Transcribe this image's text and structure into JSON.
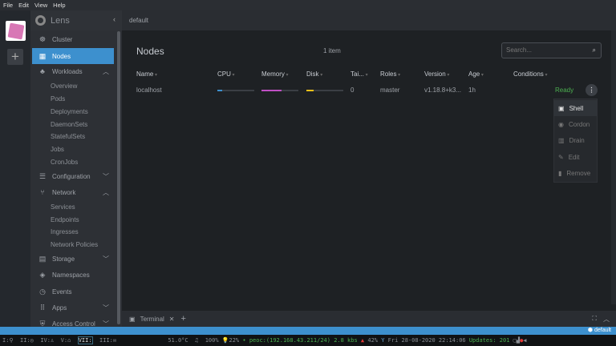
{
  "menubar": {
    "items": [
      "File",
      "Edit",
      "View",
      "Help"
    ]
  },
  "sidebar": {
    "title": "Lens",
    "items": {
      "cluster": "Cluster",
      "nodes": "Nodes",
      "workloads": "Workloads",
      "overview": "Overview",
      "pods": "Pods",
      "deployments": "Deployments",
      "daemonsets": "DaemonSets",
      "statefulsets": "StatefulSets",
      "jobs": "Jobs",
      "cronjobs": "CronJobs",
      "configuration": "Configuration",
      "network": "Network",
      "services": "Services",
      "endpoints": "Endpoints",
      "ingresses": "Ingresses",
      "network_policies": "Network Policies",
      "storage": "Storage",
      "namespaces": "Namespaces",
      "events": "Events",
      "apps": "Apps",
      "access_control": "Access Control"
    },
    "selected": "Nodes"
  },
  "topbar": {
    "context": "default"
  },
  "nodes": {
    "title": "Nodes",
    "count": "1 item",
    "search_placeholder": "Search...",
    "columns": [
      "Name",
      "CPU",
      "Memory",
      "Disk",
      "Tai...",
      "Roles",
      "Version",
      "Age",
      "Conditions"
    ],
    "rows": [
      {
        "name": "localhost",
        "cpu_usage": 0.12,
        "memory_usage": 0.55,
        "disk_usage": 0.2,
        "taints": "0",
        "roles": "master",
        "version": "v1.18.8+k3...",
        "age": "1h",
        "conditions": "Ready"
      }
    ],
    "menu": [
      "Shell",
      "Cordon",
      "Drain",
      "Edit",
      "Remove"
    ]
  },
  "colors": {
    "accent": "#3d90ce",
    "cpu": "#3d90ce",
    "memory": "#c04fc4",
    "disk": "#f2c118",
    "ready": "#4caf50"
  },
  "terminal": {
    "tab": "Terminal"
  },
  "statusbar": {
    "context": "default"
  },
  "taskbar": {
    "workspaces": [
      "I:",
      "II:",
      "IV:",
      "V:",
      "VII:",
      "III:"
    ],
    "temp": "51.0°C",
    "volume": "100%",
    "brightness": "22%",
    "network": "peoc:(192.168.43.211/24)",
    "speed": "2.8 kbs",
    "cpu": "42%",
    "date": "Fri 28-08-2020",
    "time": "22:14:06",
    "updates": "Updates: 201"
  }
}
